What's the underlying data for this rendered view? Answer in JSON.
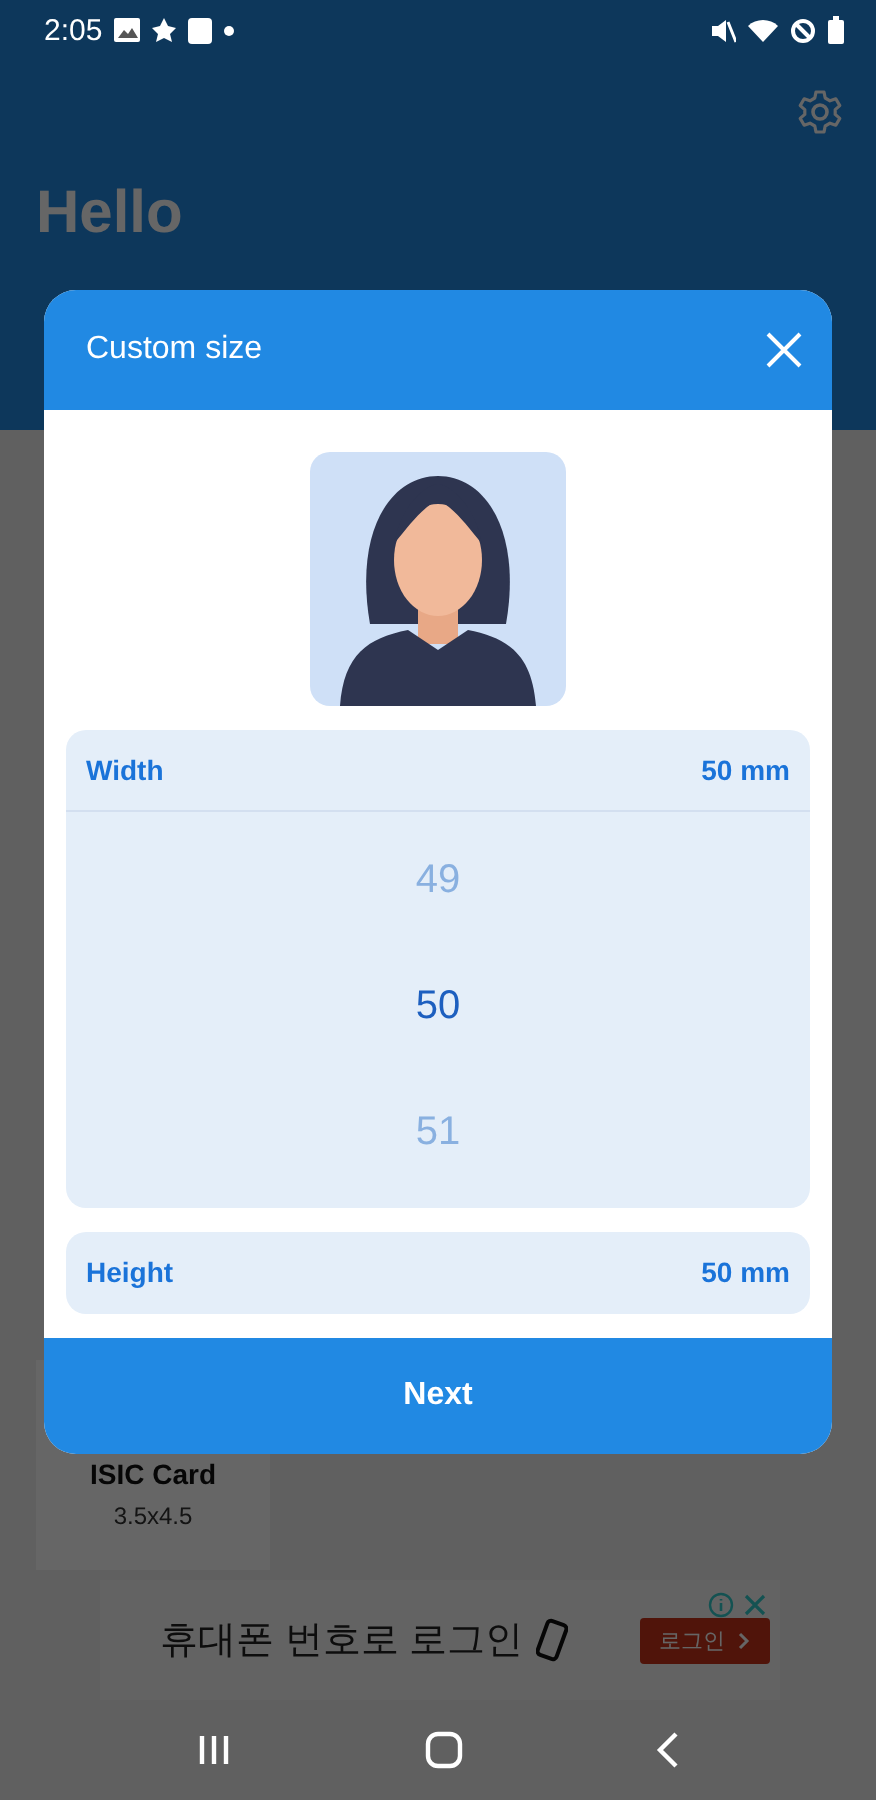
{
  "status_bar": {
    "time": "2:05"
  },
  "home": {
    "greeting": "Hello",
    "cards": [
      {
        "title": "ISIC Card",
        "size": "3.5x4.5"
      }
    ]
  },
  "ad": {
    "text": "휴대폰 번호로 로그인",
    "button": "로그인"
  },
  "dialog": {
    "title": "Custom size",
    "button": "Next",
    "fields": [
      {
        "label": "Width",
        "value": "50 mm",
        "expanded": true,
        "options": [
          {
            "text": "49",
            "selected": false
          },
          {
            "text": "50",
            "selected": true
          },
          {
            "text": "51",
            "selected": false
          }
        ]
      },
      {
        "label": "Height",
        "value": "50 mm",
        "expanded": false
      }
    ]
  }
}
